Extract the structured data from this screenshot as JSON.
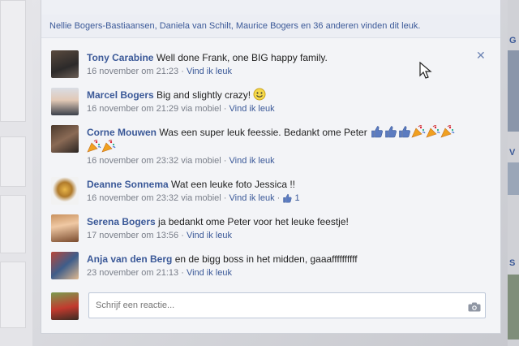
{
  "likes_summary": "Nellie Bogers-Bastiaansen, Daniela van Schilt, Maurice Bogers en 36 anderen vinden dit leuk.",
  "comments": [
    {
      "author": "Tony Carabine",
      "text": "Well done Frank, one BIG happy family.",
      "time": "16 november om 21:23",
      "via": "",
      "like": "Vind ik leuk",
      "likes": ""
    },
    {
      "author": "Marcel Bogers",
      "text": "Big and slightly crazy!",
      "time": "16 november om 21:29",
      "via": "via mobiel",
      "like": "Vind ik leuk",
      "likes": ""
    },
    {
      "author": "Corne Mouwen",
      "text": "Was een super leuk feessie. Bedankt ome Peter",
      "time": "16 november om 23:32",
      "via": "via mobiel",
      "like": "Vind ik leuk",
      "likes": ""
    },
    {
      "author": "Deanne Sonnema",
      "text": "Wat een leuke foto Jessica !!",
      "time": "16 november om 23:32",
      "via": "via mobiel",
      "like": "Vind ik leuk",
      "likes": "1"
    },
    {
      "author": "Serena Bogers",
      "text": "ja bedankt ome Peter voor het leuke feestje!",
      "time": "17 november om 13:56",
      "via": "",
      "like": "Vind ik leuk",
      "likes": ""
    },
    {
      "author": "Anja van den Berg",
      "text": "en de bigg boss in het midden, gaaaffffffffff",
      "time": "23 november om 21:13",
      "via": "",
      "like": "Vind ik leuk",
      "likes": ""
    }
  ],
  "reply_placeholder": "Schrijf een reactie...",
  "separator": "·",
  "right_rail_letters": [
    "G",
    "V",
    "S"
  ],
  "icons": {
    "close": "close-icon",
    "camera": "camera-icon",
    "thumbs_up": "thumbs-up-icon",
    "party": "party-popper-icon",
    "smiley": "smiley-icon"
  },
  "colors": {
    "link": "#3b5998",
    "meta": "#7a7f8a",
    "card_bg": "#f3f4f7"
  }
}
